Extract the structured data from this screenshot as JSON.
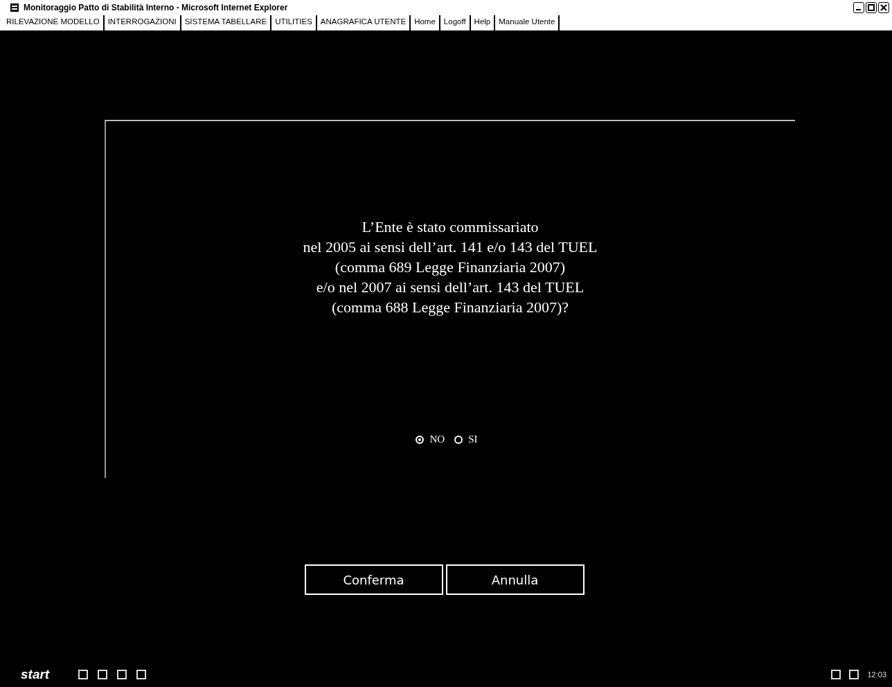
{
  "window": {
    "title": "Monitoraggio Patto di Stabilità Interno - Microsoft Internet Explorer"
  },
  "menu": [
    "RILEVAZIONE MODELLO",
    "INTERROGAZIONI",
    "SISTEMA TABELLARE",
    "UTILITIES",
    "ANAGRAFICA UTENTE",
    "Home",
    "Logoff",
    "Help",
    "Manuale Utente"
  ],
  "question": [
    "L’Ente è stato commissariato",
    "nel 2005 ai sensi dell’art. 141 e/o 143 del TUEL",
    "(comma 689 Legge Finanziaria 2007)",
    "e/o nel 2007 ai sensi dell’art. 143 del TUEL",
    "(comma 688 Legge Finanziaria 2007)?"
  ],
  "options": [
    {
      "label": "NO",
      "selected": true
    },
    {
      "label": "SI",
      "selected": false
    }
  ],
  "buttons": [
    "Conferma",
    "Annulla"
  ],
  "taskbar": {
    "start": "start",
    "clock": "12:03"
  }
}
